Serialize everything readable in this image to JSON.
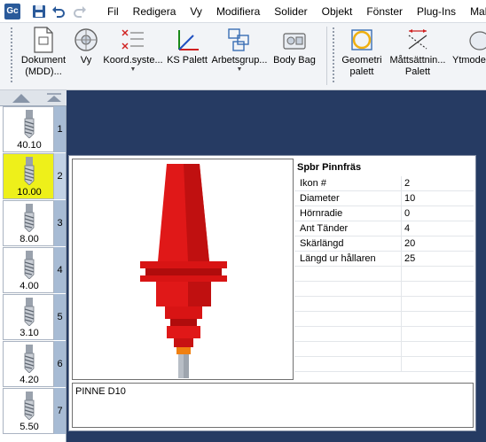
{
  "app": {
    "logo": "Gc"
  },
  "quick_access": [
    {
      "name": "save-icon"
    },
    {
      "name": "undo-icon"
    },
    {
      "name": "redo-icon"
    }
  ],
  "menu": [
    "Fil",
    "Redigera",
    "Vy",
    "Modifiera",
    "Solider",
    "Objekt",
    "Fönster",
    "Plug-Ins",
    "Makro"
  ],
  "ribbon": {
    "dokument": {
      "line1": "Dokument",
      "line2": "(MDD)..."
    },
    "vy": "Vy",
    "koord": "Koord.syste...",
    "ks_palett": "KS Palett",
    "arbetsgrupp": "Arbetsgrup...",
    "body_bag": "Body Bag",
    "geometri": {
      "line1": "Geometri",
      "line2": "palett"
    },
    "mattsattning": {
      "line1": "Måttsättnin...",
      "line2": "Palett"
    },
    "ytmode": "Ytmode"
  },
  "tools": [
    {
      "num": "1",
      "value": "40.10",
      "active": false
    },
    {
      "num": "2",
      "value": "10.00",
      "active": true
    },
    {
      "num": "3",
      "value": "8.00",
      "active": false
    },
    {
      "num": "4",
      "value": "4.00",
      "active": false
    },
    {
      "num": "5",
      "value": "3.10",
      "active": false
    },
    {
      "num": "6",
      "value": "4.20",
      "active": false
    },
    {
      "num": "7",
      "value": "5.50",
      "active": false
    }
  ],
  "tool_info": {
    "title": "Spbr Pinnfräs",
    "properties": [
      {
        "name": "Ikon #",
        "value": "2"
      },
      {
        "name": "Diameter",
        "value": "10"
      },
      {
        "name": "Hörnradie",
        "value": "0"
      },
      {
        "name": "Ant Tänder",
        "value": "4"
      },
      {
        "name": "Skärlängd",
        "value": "20"
      },
      {
        "name": "Längd ur hållaren",
        "value": "25"
      }
    ],
    "description": "PINNE D10"
  },
  "colors": {
    "holder_red": "#e01818",
    "accent_orange": "#f08010",
    "active_yellow": "#eef01a",
    "workspace": "#263b63"
  }
}
